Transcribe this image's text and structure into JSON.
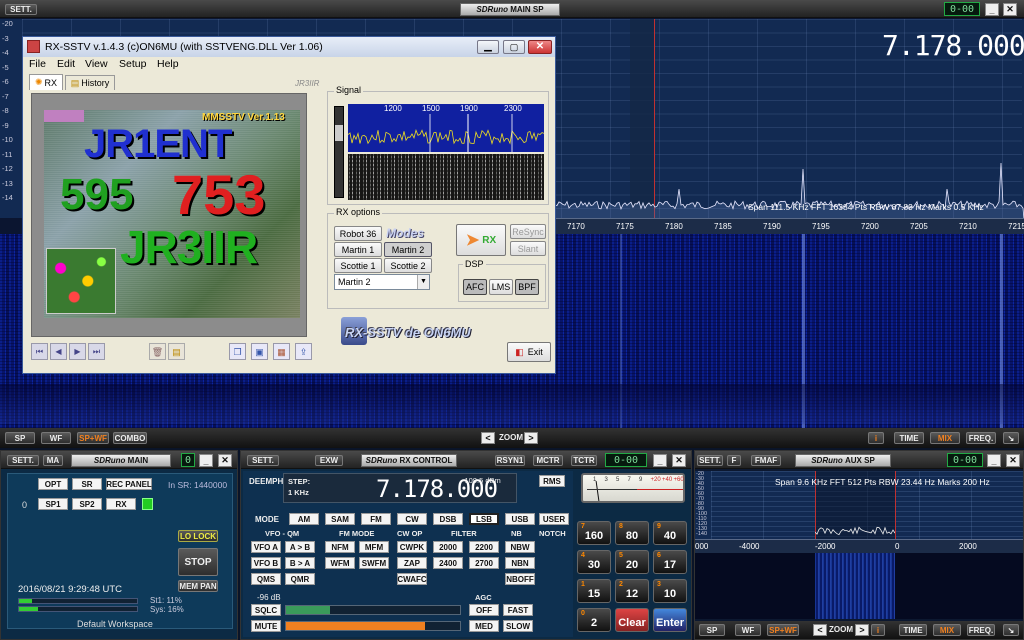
{
  "main_sp": {
    "settings": "SETT.",
    "title_logo": "SDRuno",
    "title": "MAIN SP",
    "segment": "0-00",
    "db_ticks": [
      "-20",
      "-3",
      "-4",
      "-5",
      "-6",
      "-7",
      "-8",
      "-9",
      "-10",
      "-11",
      "-12",
      "-13",
      "-14"
    ],
    "frequency": "7.178.000",
    "info": "Span 111.5 KHz   FFT 16384 Pts   RBW 87.89 Hz   Marks 0.5 KHz",
    "freq_ticks": [
      "7170",
      "7175",
      "7180",
      "7185",
      "7190",
      "7195",
      "7200",
      "7205",
      "7210",
      "7215"
    ],
    "view_buttons": [
      "SP",
      "WF",
      "SP+WF",
      "COMBO"
    ],
    "zoom": "ZOOM",
    "right_buttons": [
      "i",
      "TIME",
      "MIX",
      "FREQ."
    ]
  },
  "rxsstv": {
    "title": "RX-SSTV v.1.4.3 (c)ON6MU (with SSTVENG.DLL Ver 1.06)",
    "menu": [
      "File",
      "Edit",
      "View",
      "Setup",
      "Help"
    ],
    "tabs": [
      "RX",
      "History"
    ],
    "callsign_label": "JR3IIR",
    "image_text": {
      "line1": "JR1ENT",
      "line2a": "595",
      "line2b": "753",
      "line3": "JR3IIR",
      "banner": "MMSSTV Ver.1.13"
    },
    "signal_label": "Signal",
    "signal_ticks": [
      "1200",
      "1500",
      "1900",
      "2300"
    ],
    "rx_options_label": "RX options",
    "modes_label": "Modes",
    "modes": [
      "Robot 36",
      "Martin 1",
      "Martin 2",
      "Scottie 1",
      "Scottie 2"
    ],
    "selected_mode": "Martin 2",
    "rx_button": "RX",
    "resync": "ReSync",
    "slant": "Slant",
    "dsp_label": "DSP",
    "dsp_buttons": [
      "AFC",
      "LMS",
      "BPF"
    ],
    "logo": "RX-SSTV de ON6MU",
    "exit": "Exit"
  },
  "main_panel": {
    "settings": "SETT.",
    "ma": "MA",
    "title_logo": "SDRuno",
    "title": "MAIN",
    "segment": "0",
    "buttons": [
      "OPT",
      "SR",
      "REC PANEL",
      "SP1",
      "SP2",
      "RX"
    ],
    "in_sr": "In SR: 1440000",
    "zero": "0",
    "lo_lock": "LO LOCK",
    "stop": "STOP",
    "mem_pan": "MEM PAN",
    "datetime": "2016/08/21 9:29:48 UTC",
    "st1": "St1: 11%",
    "sys": "Sys: 16%",
    "workspace": "Default Workspace",
    "st1_level": 0.11,
    "sys_level": 0.16
  },
  "rx_control": {
    "settings": "SETT.",
    "exw": "EXW",
    "title_logo": "SDRuno",
    "title": "RX CONTROL",
    "rsyn": "RSYN1",
    "mctr": "MCTR",
    "tctr": "TCTR",
    "segment": "0-00",
    "deemph": "DEEMPH",
    "step": "STEP:",
    "step_val": "1 KHz",
    "frequency": "7.178.000",
    "level": "-109.5 dBm",
    "rms": "RMS",
    "mode_label": "MODE",
    "modes": [
      "AM",
      "SAM",
      "FM",
      "CW",
      "DSB",
      "LSB",
      "USB",
      "USER"
    ],
    "vfo_qm": "VFO - QM",
    "fm_mode": "FM MODE",
    "cw_op": "CW OP",
    "filter": "FILTER",
    "nb": "NB",
    "notch": "NOTCH",
    "row1": [
      "VFO A",
      "A > B",
      "NFM",
      "MFM",
      "CWPK",
      "2000",
      "2200",
      "NBW"
    ],
    "row2": [
      "VFO B",
      "B > A",
      "WFM",
      "SWFM",
      "ZAP",
      "2400",
      "2700",
      "NBN"
    ],
    "row3": [
      "QMS",
      "QMR",
      "CWAFC",
      "NBOFF"
    ],
    "sql_db": "-96 dB",
    "agc": "AGC",
    "sqlc": "SQLC",
    "mute": "MUTE",
    "agc_off": "OFF",
    "agc_med": "MED",
    "fast": "FAST",
    "slow": "SLOW",
    "sql_level": 0.25,
    "vol_level": 0.8
  },
  "smeter": {
    "ticks": [
      "1",
      "3",
      "5",
      "7",
      "9",
      "+20",
      "+40",
      "+60"
    ]
  },
  "keypad": {
    "keys": [
      [
        "7",
        "160"
      ],
      [
        "8",
        "80"
      ],
      [
        "9",
        "40"
      ],
      [
        "4",
        "30"
      ],
      [
        "5",
        "20"
      ],
      [
        "6",
        "17"
      ],
      [
        "1",
        "15"
      ],
      [
        "2",
        "12"
      ],
      [
        "3",
        "10"
      ],
      [
        "0",
        "2"
      ]
    ],
    "clear": "Clear",
    "enter": "Enter"
  },
  "aux_sp": {
    "settings": "SETT.",
    "f": "F",
    "fmaf": "FMAF",
    "title_logo": "SDRuno",
    "title": "AUX SP",
    "segment": "0-00",
    "info": "Span 9.6 KHz   FFT 512 Pts   RBW 23.44 Hz   Marks 200 Hz",
    "db_ticks": [
      "-20",
      "-30",
      "-40",
      "-50",
      "-60",
      "-70",
      "-80",
      "-90",
      "-100",
      "-110",
      "-120",
      "-130",
      "-140"
    ],
    "freq_ticks": [
      "000",
      "-4000",
      "-2000",
      "0",
      "2000"
    ],
    "view_buttons": [
      "SP",
      "WF",
      "SP+WF",
      "ZOOM",
      "i",
      "TIME",
      "MIX",
      "FREQ."
    ]
  },
  "colors": {
    "spectrum_bg": "#0f2850",
    "waterfall": "#0a1a7a",
    "accent": "#f08020",
    "marker": "#c03030"
  }
}
